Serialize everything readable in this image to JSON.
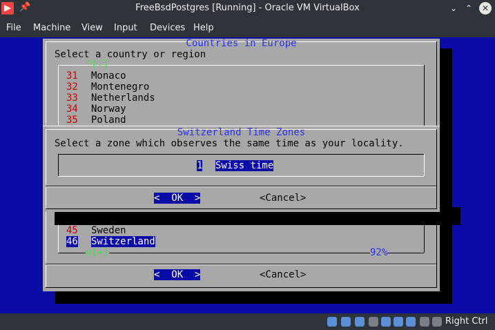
{
  "window": {
    "title": "FreeBsdPostgres [Running] - Oracle VM VirtualBox"
  },
  "menu": [
    "File",
    "Machine",
    "View",
    "Input",
    "Devices",
    "Help"
  ],
  "back_dialog": {
    "title": "Countries in Europe",
    "prompt": "Select a country or region",
    "scroll_up": "^(-)",
    "items": [
      {
        "num": "31",
        "name": "Monaco"
      },
      {
        "num": "32",
        "name": "Montenegro"
      },
      {
        "num": "33",
        "name": "Netherlands"
      },
      {
        "num": "34",
        "name": "Norway"
      },
      {
        "num": "35",
        "name": "Poland"
      },
      {
        "num": "45",
        "name": "Sweden"
      },
      {
        "num": "46",
        "name": "Switzerland"
      }
    ],
    "scroll_down": "v(+)",
    "percent": "92%",
    "ok": "<  OK  >",
    "cancel": "<Cancel>"
  },
  "front_dialog": {
    "title": "Switzerland Time Zones",
    "prompt": "Select a zone which observes the same time as your locality.",
    "item_num": "1",
    "item_name": "Swiss time",
    "ok": "<  OK  >",
    "cancel": "<Cancel>"
  },
  "status": {
    "host_key": "Right Ctrl"
  }
}
